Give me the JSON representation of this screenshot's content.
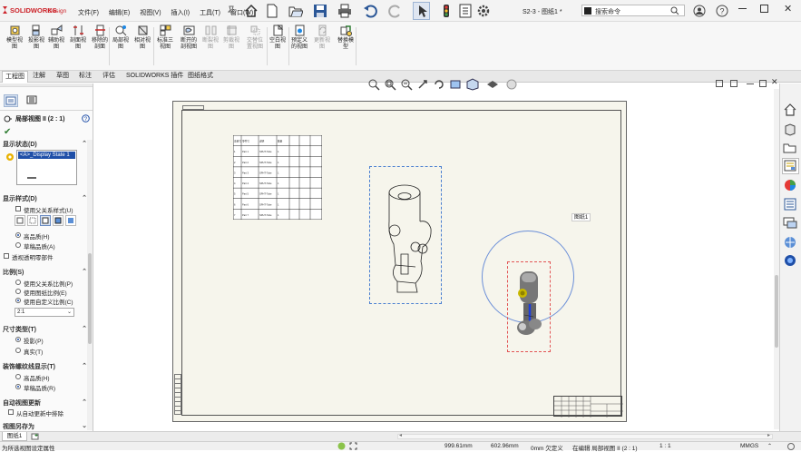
{
  "app": {
    "brand": "SOLIDWORKS",
    "edition": "Design",
    "doc_title": "S2-3 - 图纸1 *"
  },
  "menu": [
    "文件(F)",
    "编辑(E)",
    "视图(V)",
    "插入(I)",
    "工具(T)",
    "窗口(W)"
  ],
  "search": {
    "placeholder": "搜索命令"
  },
  "ribbon": [
    {
      "label": "模型视\n图",
      "icon": "model-view-icon",
      "enabled": true
    },
    {
      "label": "投影视\n图",
      "icon": "projected-view-icon",
      "enabled": true
    },
    {
      "label": "辅助视\n图",
      "icon": "auxiliary-view-icon",
      "enabled": true
    },
    {
      "label": "剖面视\n图",
      "icon": "section-view-icon",
      "enabled": true
    },
    {
      "label": "移除的\n剖面",
      "icon": "removed-section-icon",
      "enabled": true
    },
    {
      "label": "局部视\n图",
      "icon": "detail-view-icon",
      "enabled": true
    },
    {
      "label": "相对视\n图",
      "icon": "relative-view-icon",
      "enabled": true
    },
    {
      "label": "标准三\n视图",
      "icon": "standard-3view-icon",
      "enabled": true
    },
    {
      "label": "断开的\n剖视图",
      "icon": "broken-out-section-icon",
      "enabled": true
    },
    {
      "label": "断裂视\n图",
      "icon": "break-view-icon",
      "enabled": false
    },
    {
      "label": "剪裁视\n图",
      "icon": "crop-view-icon",
      "enabled": false
    },
    {
      "label": "交替位\n置视图",
      "icon": "alternate-position-icon",
      "enabled": false
    },
    {
      "label": "空白视\n图",
      "icon": "empty-view-icon",
      "enabled": true
    },
    {
      "label": "预定义\n的视图",
      "icon": "predefined-view-icon",
      "enabled": true
    },
    {
      "label": "更新视\n图",
      "icon": "update-view-icon",
      "enabled": false
    },
    {
      "label": "替换模\n型",
      "icon": "replace-model-icon",
      "enabled": true
    }
  ],
  "tabs": [
    "工程图",
    "注解",
    "草图",
    "标注",
    "评估",
    "SOLIDWORKS 插件",
    "图纸格式"
  ],
  "panel": {
    "title": "局部视图 II (2 : 1)",
    "display_state_heading": "显示状态(D)",
    "display_state_item": "<A>_Display State 1",
    "display_style_heading": "显示样式(D)",
    "use_parent_style": "使用父关系样式(U)",
    "high_quality": "高品质(H)",
    "draft_quality": "草稿品质(A)",
    "transparent_parts": "透视透明零部件",
    "scale_heading": "比例(S)",
    "scale_parent": "使用父关系比例(P)",
    "scale_sheet": "使用图纸比例(E)",
    "scale_custom": "使用自定义比例(C)",
    "scale_value": "2:1",
    "dim_type_heading": "尺寸类型(T)",
    "dim_projected": "投影(P)",
    "dim_true": "真实(T)",
    "thread_heading": "装饰螺纹线显示(T)",
    "thread_high": "高品质(H)",
    "thread_draft": "草稿品质(R)",
    "auto_update_heading": "自动视图更新",
    "auto_update_exclude": "从自动更新中排除",
    "save_as_heading": "视图另存为"
  },
  "drawing": {
    "sheet_label": "图纸1"
  },
  "bom": {
    "headers": [
      "项目号",
      "零件号",
      "说明",
      "数量",
      "",
      "",
      ""
    ],
    "rows": [
      [
        "1",
        "Part 1",
        "SPHT-Tube",
        "1",
        "",
        "",
        ""
      ],
      [
        "2",
        "Part 2",
        "SPHT-Tube",
        "1",
        "",
        "",
        ""
      ],
      [
        "3",
        "Part 3",
        "SPHT-Tube",
        "1",
        "",
        "",
        ""
      ],
      [
        "4",
        "Part 4",
        "SPHT-Tube",
        "1",
        "",
        "",
        ""
      ],
      [
        "5",
        "Part 5",
        "SPHT-Tube",
        "1",
        "",
        "",
        ""
      ],
      [
        "6",
        "Part 6",
        "SPHT-Tube",
        "1",
        "",
        "",
        ""
      ],
      [
        "7",
        "Part 7",
        "SPHT-Tube",
        "1",
        "",
        "",
        ""
      ]
    ]
  },
  "sheet_tab": "图纸1",
  "status": {
    "hint": "为所选视图设定属性",
    "x": "999.61mm",
    "y": "602.96mm",
    "defined": "0mm 欠定义",
    "editing": "在编辑 局部视图 II (2 : 1)",
    "scale": "1 : 1",
    "units": "MMGS"
  },
  "colors": {
    "accent": "#1f4fa8",
    "brand_red": "#cc2027",
    "sheet_bg": "#f6f5ec",
    "highlight": "#ffeb3b"
  }
}
